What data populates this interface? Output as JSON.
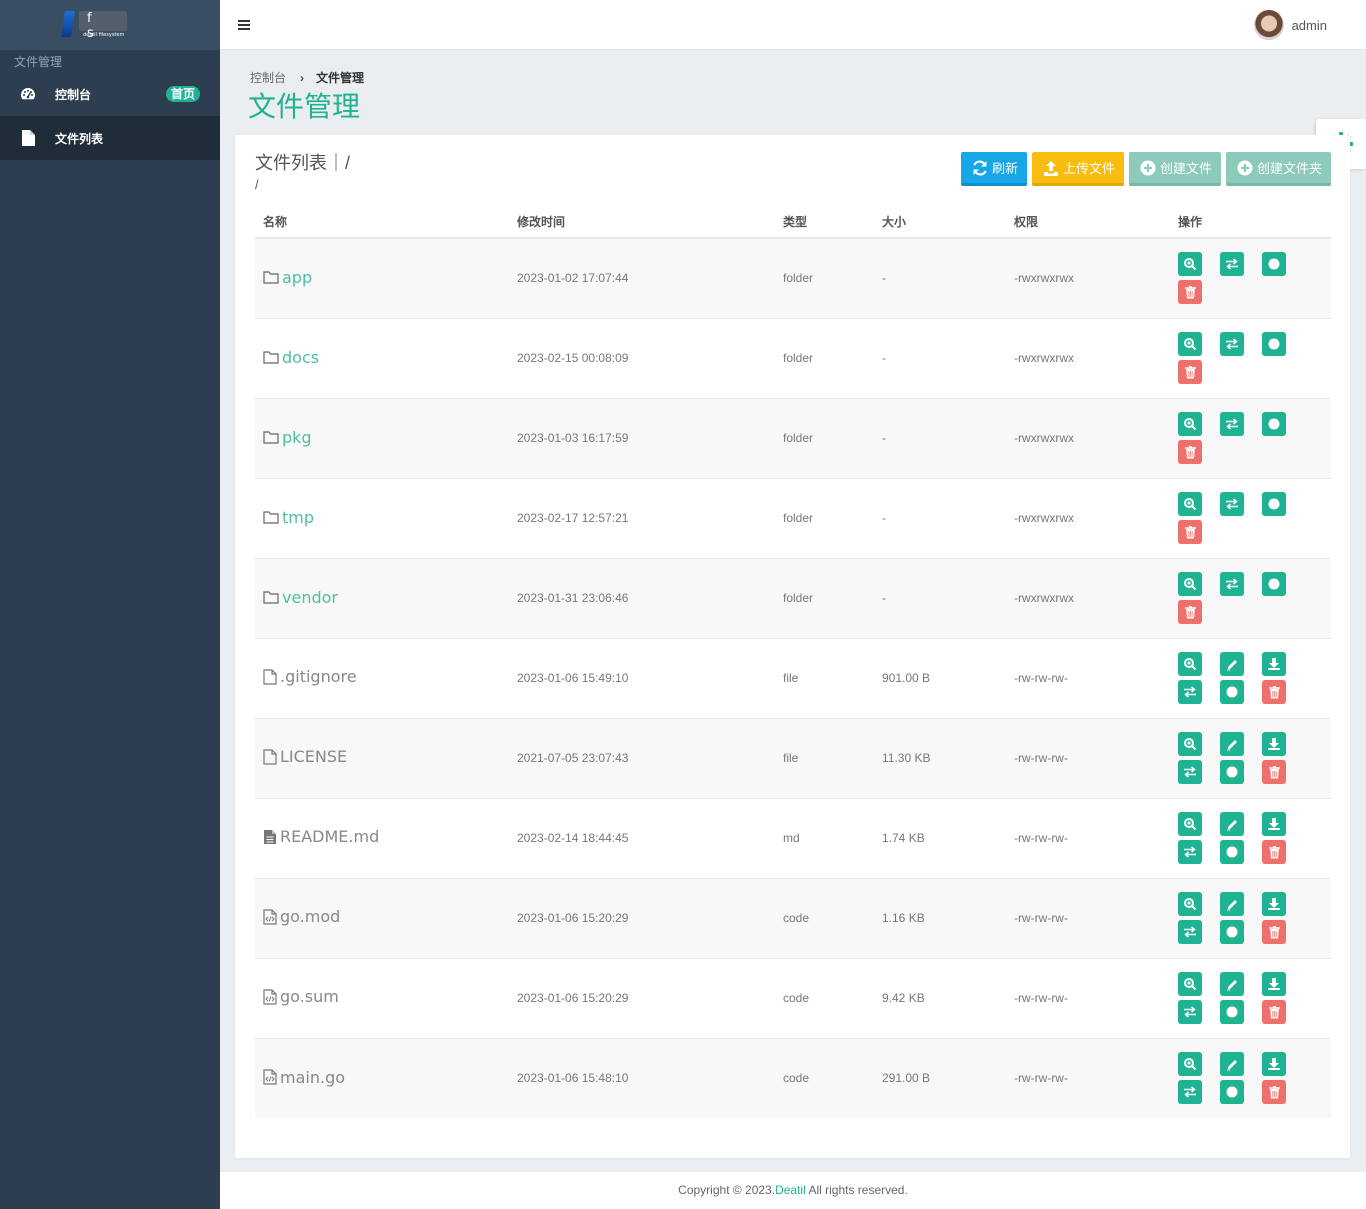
{
  "sidebar": {
    "logo_text": "f s",
    "logo_subtext": "deatil filesystem",
    "header": "文件管理",
    "items": [
      {
        "label": "控制台",
        "badge": "首页",
        "icon": "dashboard-icon"
      },
      {
        "label": "文件列表",
        "icon": "file-icon"
      }
    ]
  },
  "topbar": {
    "username": "admin"
  },
  "breadcrumb": {
    "home": "控制台",
    "current": "文件管理"
  },
  "page_title": "文件管理",
  "panel": {
    "title": "文件列表｜/",
    "path": "/",
    "buttons": {
      "refresh": "刷新",
      "upload": "上传文件",
      "create_file": "创建文件",
      "create_folder": "创建文件夹"
    }
  },
  "table": {
    "headers": [
      "名称",
      "修改时间",
      "类型",
      "大小",
      "权限",
      "操作"
    ],
    "rows": [
      {
        "name": "app",
        "time": "2023-01-02 17:07:44",
        "type": "folder",
        "size": "-",
        "perm": "-rwxrwxrwx",
        "kind": "folder"
      },
      {
        "name": "docs",
        "time": "2023-02-15 00:08:09",
        "type": "folder",
        "size": "-",
        "perm": "-rwxrwxrwx",
        "kind": "folder"
      },
      {
        "name": "pkg",
        "time": "2023-01-03 16:17:59",
        "type": "folder",
        "size": "-",
        "perm": "-rwxrwxrwx",
        "kind": "folder"
      },
      {
        "name": "tmp",
        "time": "2023-02-17 12:57:21",
        "type": "folder",
        "size": "-",
        "perm": "-rwxrwxrwx",
        "kind": "folder"
      },
      {
        "name": "vendor",
        "time": "2023-01-31 23:06:46",
        "type": "folder",
        "size": "-",
        "perm": "-rwxrwxrwx",
        "kind": "folder"
      },
      {
        "name": ".gitignore",
        "time": "2023-01-06 15:49:10",
        "type": "file",
        "size": "901.00 B",
        "perm": "-rw-rw-rw-",
        "kind": "file"
      },
      {
        "name": "LICENSE",
        "time": "2021-07-05 23:07:43",
        "type": "file",
        "size": "11.30 KB",
        "perm": "-rw-rw-rw-",
        "kind": "file"
      },
      {
        "name": "README.md",
        "time": "2023-02-14 18:44:45",
        "type": "md",
        "size": "1.74 KB",
        "perm": "-rw-rw-rw-",
        "kind": "md"
      },
      {
        "name": "go.mod",
        "time": "2023-01-06 15:20:29",
        "type": "code",
        "size": "1.16 KB",
        "perm": "-rw-rw-rw-",
        "kind": "code"
      },
      {
        "name": "go.sum",
        "time": "2023-01-06 15:20:29",
        "type": "code",
        "size": "9.42 KB",
        "perm": "-rw-rw-rw-",
        "kind": "code"
      },
      {
        "name": "main.go",
        "time": "2023-01-06 15:48:10",
        "type": "code",
        "size": "291.00 B",
        "perm": "-rw-rw-rw-",
        "kind": "code"
      }
    ]
  },
  "footer": {
    "prefix": "Copyright © 2023.",
    "brand": "Deatil",
    "suffix": " All rights reserved."
  },
  "colors": {
    "accent": "#1fb393",
    "danger": "#ef6f6c",
    "sidebar": "#2d3e50",
    "blue": "#17a7e6",
    "yellow": "#f9bd0f"
  }
}
